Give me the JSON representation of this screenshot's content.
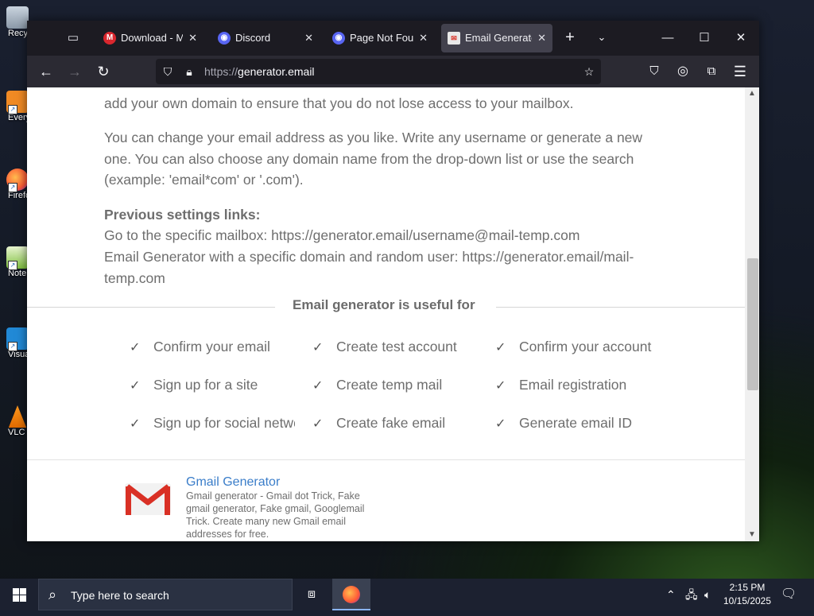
{
  "desktop": {
    "icons": [
      {
        "label": "Recycle Bin",
        "icon": "recycle-bin-icon"
      },
      {
        "label": "Everything",
        "icon": "everything-icon"
      },
      {
        "label": "Firefox",
        "icon": "firefox-icon"
      },
      {
        "label": "Notepad++",
        "icon": "notepad-icon"
      },
      {
        "label": "Visual Studio Code",
        "icon": "vscode-icon"
      },
      {
        "label": "VLC media player",
        "icon": "vlc-icon"
      }
    ]
  },
  "browser": {
    "tabs": [
      {
        "title": "Download - MEGA",
        "favicon": "mega-icon",
        "active": false
      },
      {
        "title": "Discord",
        "favicon": "discord-icon",
        "active": false
      },
      {
        "title": "Page Not Found",
        "favicon": "discord-icon",
        "active": false
      },
      {
        "title": "Email Generator",
        "favicon": "email-generator-icon",
        "active": true
      }
    ],
    "url_scheme": "https://",
    "url_host": "generator.email"
  },
  "page": {
    "para1": "add your own domain to ensure that you do not lose access to your mailbox.",
    "para2": "You can change your email address as you like. Write any username or generate a new one. You can also choose any domain name from the drop-down list or use the search (example: 'email*com' or '.com').",
    "settings_heading": "Previous settings links:",
    "settings_line1": "Go to the specific mailbox: https://generator.email/username@mail-temp.com",
    "settings_line2": "Email Generator with a specific domain and random user: https://generator.email/mail-temp.com",
    "useful_title": "Email generator is useful for",
    "features": [
      "Confirm your email",
      "Create test account",
      "Confirm your account",
      "Sign up for a site",
      "Create temp mail",
      "Email registration",
      "Sign up for social network",
      "Create fake email",
      "Generate email ID"
    ],
    "card": {
      "title": "Gmail Generator",
      "description": "Gmail generator - Gmail dot Trick, Fake gmail generator, Fake gmail, Googlemail Trick. Create many new Gmail email addresses for free."
    }
  },
  "taskbar": {
    "search_placeholder": "Type here to search",
    "time": "2:15 PM",
    "date": "10/15/2025"
  },
  "colors": {
    "link": "#3a7dc9",
    "gmail_red": "#d93025",
    "browser_dark": "#1c1b22"
  }
}
